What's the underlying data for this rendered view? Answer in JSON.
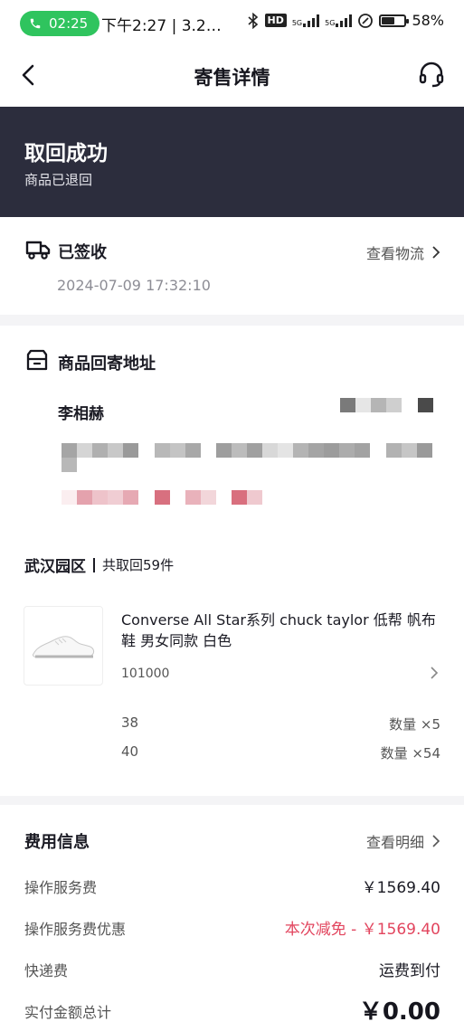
{
  "status_bar": {
    "call_time": "02:25",
    "text": "下午2:27 | 3.2…",
    "hd_badge": "HD",
    "net_label_1": "5G",
    "net_label_2": "5G",
    "battery_text": "58%",
    "battery_level_percent": 58
  },
  "nav": {
    "title": "寄售详情",
    "back_icon": "chevron-left-icon",
    "service_icon": "headset-icon"
  },
  "banner": {
    "title": "取回成功",
    "subtitle": "商品已退回",
    "background": "#2c2d3d"
  },
  "logistics": {
    "status": "已签收",
    "link": "查看物流",
    "time": "2024-07-09 17:32:10"
  },
  "address": {
    "title": "商品回寄地址",
    "recipient": "李相赫"
  },
  "return_info": {
    "warehouse": "武汉园区",
    "count_text": "共取回59件"
  },
  "product": {
    "name": "Converse All Star系列 chuck taylor 低帮 帆布鞋 男女同款 白色",
    "code": "101000",
    "sizes": [
      {
        "size": "38",
        "quantity": "数量 ×5"
      },
      {
        "size": "40",
        "quantity": "数量 ×54"
      }
    ]
  },
  "fees": {
    "title": "费用信息",
    "link": "查看明细",
    "items": [
      {
        "label": "操作服务费",
        "value": "￥1569.40"
      },
      {
        "label": "操作服务费优惠",
        "value": "本次减免 - ￥1569.40"
      },
      {
        "label": "快递费",
        "value": "运费到付"
      },
      {
        "label": "实付金额总计",
        "value": "￥0.00"
      }
    ],
    "discount_color": "#e2455e"
  }
}
